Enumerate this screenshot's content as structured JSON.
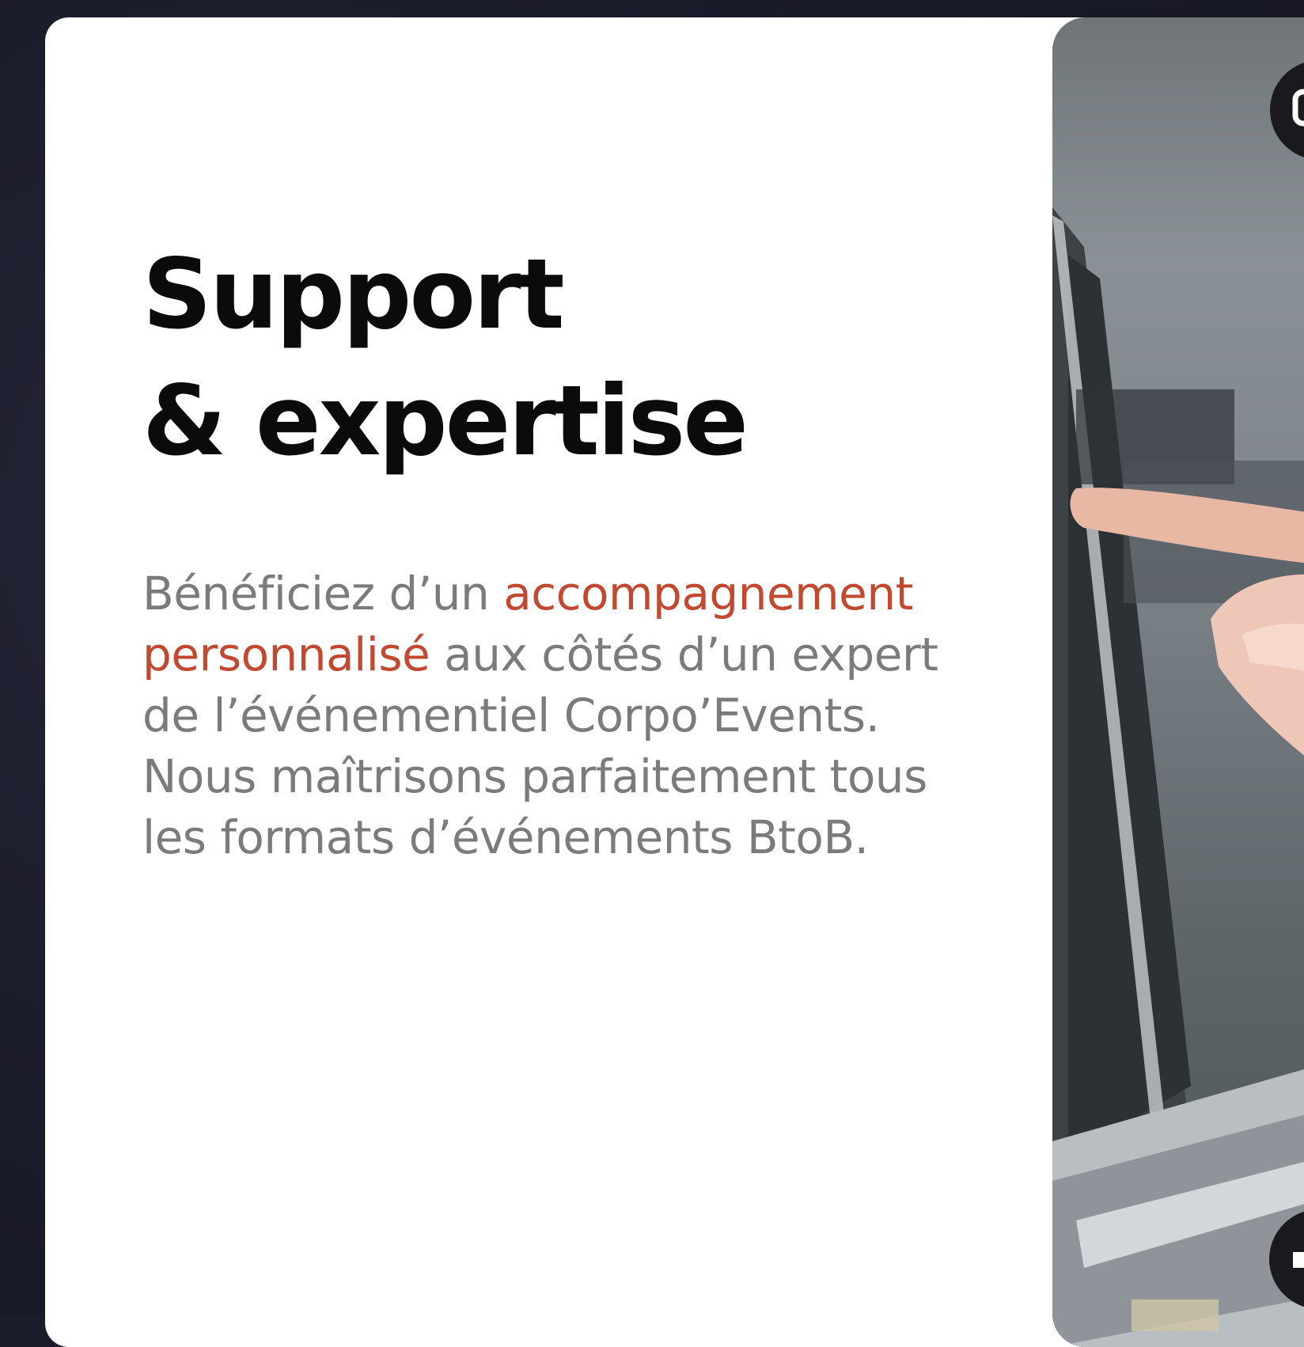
{
  "section": {
    "title_line1": "Support",
    "title_line2": "& expertise",
    "desc_before": "Bénéficiez d’un ",
    "desc_accent": "accompagnement personnalisé",
    "desc_after": " aux côtés d’un expert de l’événementiel Corpo’Events. Nous maîtrisons parfaitement tous les formats d’événements BtoB."
  },
  "colors": {
    "accent": "#c2482f",
    "title": "#0b0b0b",
    "body_text": "#7b7b7d",
    "background": "#1b1c2b",
    "card": "#ffffff"
  },
  "video": {
    "pip_icon": "picture-in-picture-icon",
    "mute_icon": "speaker-muted-icon"
  }
}
